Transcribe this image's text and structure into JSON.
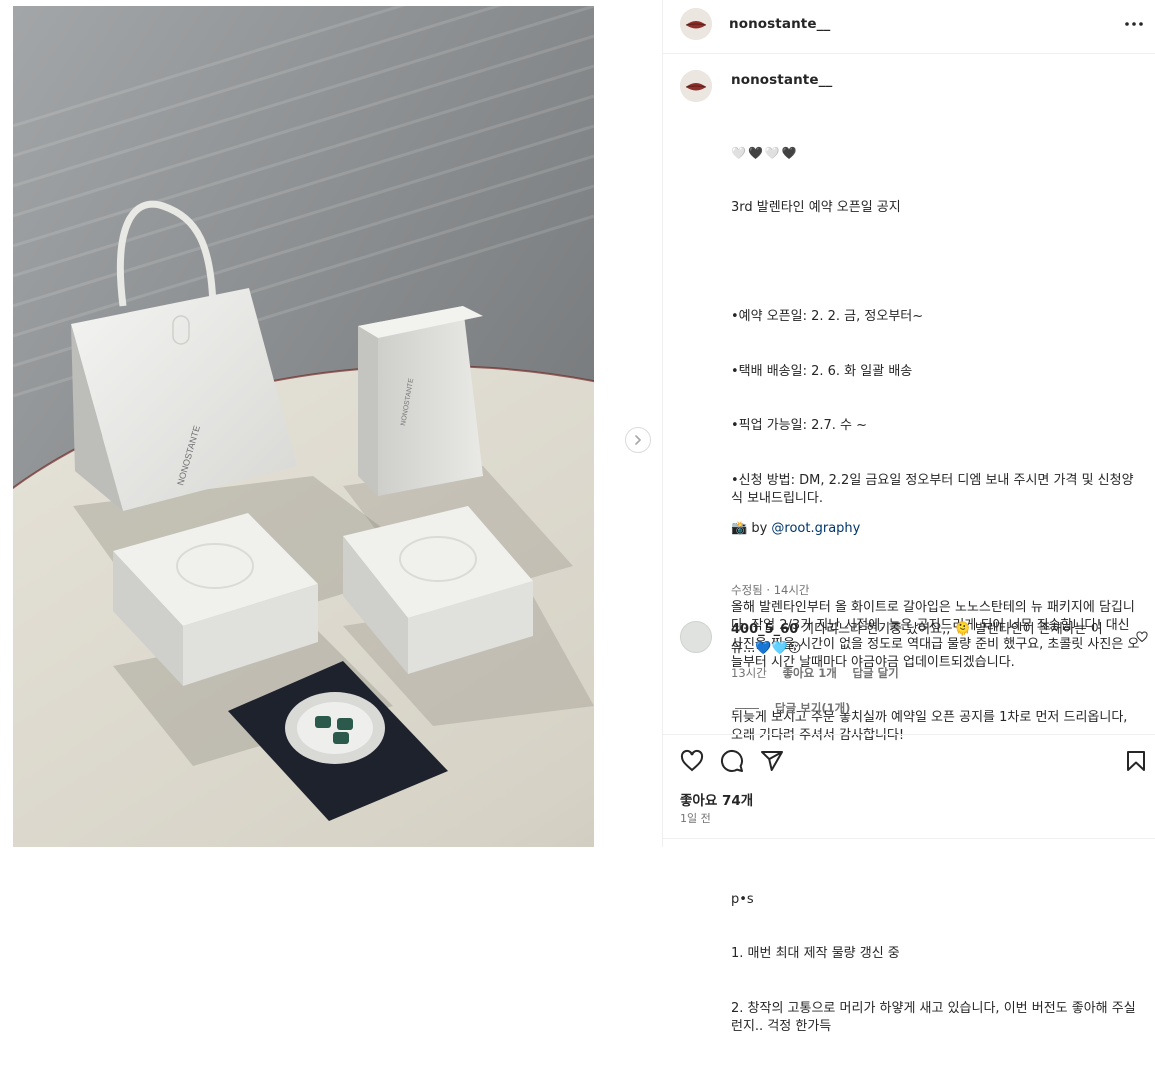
{
  "post": {
    "username": "nonostante__",
    "more_icon": "more-horizontal-icon",
    "caption": {
      "hearts": "🤍🖤🤍🖤",
      "lines": [
        "3rd 발렌타인 예약 오픈일 공지",
        "",
        "•예약 오픈일: 2. 2. 금, 정오부터~",
        "•택배 배송일: 2. 6. 화 일괄 배송",
        "•픽업 가능일: 2.7. 수 ~",
        "•신청 방법: DM, 2.2일 금요일 정오부터 디엠 보내 주시면 가격 및 신청양식 보내드립니다.",
        "",
        "올해 발렌타인부터 올 화이트로 갈아입은 노노스탄테의 뉴 패키지에 담깁니다. 작업 2/3가 지난 시점에, 늦은 공지드리게 되어 너무 죄송합니다! 대신 사진을 찍을 시간이 없을 정도로 역대급 물량 준비 했구요, 초콜릿 사진은 오늘부터 시간 날때마다 야금야금 업데이트되겠습니다.",
        "뒤늦게 보시고 주문 놓치실까 예약일 오픈 공지를 1차로 먼저 드리옵니다, 오래 기다려 주셔서 감사합니다!",
        "",
        "",
        "p•s",
        "1. 매번 최대 제작 물량 갱신 중",
        "2. 창작의 고통으로 머리가 하얗게 새고 있습니다, 이번 버전도 좋아해 주실런지.. 걱정 한가득"
      ],
      "credit_prefix": "📸 by ",
      "credit_mention": "@root.graphy",
      "edited_time": "수정됨 · 14시간"
    },
    "comment": {
      "username": "400_5_60",
      "text": "기다리느라 현기증 났어요,, 🫠 발렌타인이 존재하는 이유...💙🩵😚",
      "time": "13시간",
      "likes": "좋아요 1개",
      "reply": "답글 달기",
      "view_replies": "답글 보기(1개)"
    },
    "likes": "좋아요 74개",
    "posted": "1일 전"
  },
  "icons": {
    "like": "heart-icon",
    "comment": "comment-icon",
    "share": "send-icon",
    "save": "bookmark-icon",
    "next": "chevron-right-icon"
  },
  "colors": {
    "text": "#262626",
    "muted": "#737373",
    "link": "#00376b",
    "divider": "#efefef"
  }
}
